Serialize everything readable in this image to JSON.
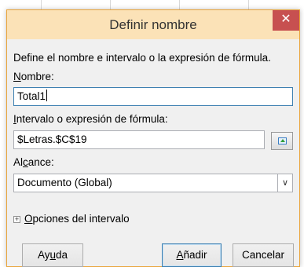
{
  "dialog": {
    "title": "Definir nombre",
    "close_label": "✕",
    "description": "Define el nombre e intervalo o la expresión de fórmula.",
    "name_label_u": "N",
    "name_label_rest": "ombre:",
    "name_value": "Total1",
    "range_label_u": "I",
    "range_label_rest": "ntervalo o expresión de fórmula:",
    "range_value": "$Letras.$C$19",
    "scope_label_pre": "Al",
    "scope_label_u": "c",
    "scope_label_rest": "ance:",
    "scope_value": "Documento (Global)",
    "options_label_u": "O",
    "options_label_rest": "pciones del intervalo",
    "help_pre": "Ay",
    "help_u": "u",
    "help_rest": "da",
    "add_u": "A",
    "add_rest": "ñadir",
    "cancel_label": "Cancelar"
  }
}
